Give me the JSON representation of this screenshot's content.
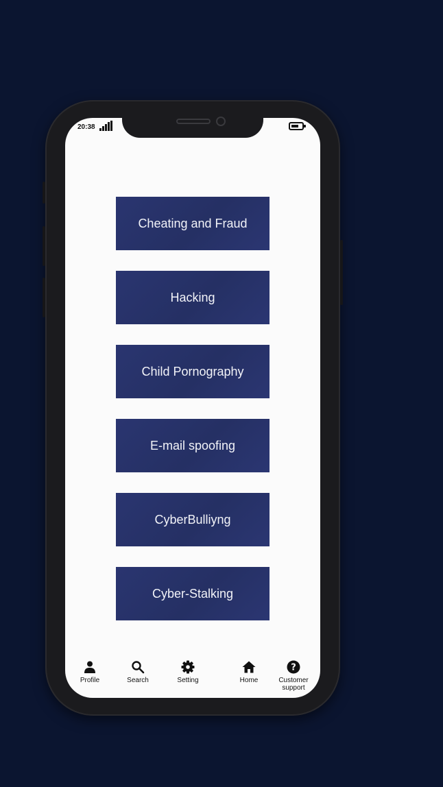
{
  "status_bar": {
    "time": "20:38"
  },
  "categories": [
    {
      "label": "Cheating and Fraud"
    },
    {
      "label": "Hacking"
    },
    {
      "label": "Child Pornography"
    },
    {
      "label": "E-mail spoofing"
    },
    {
      "label": "CyberBulliyng"
    },
    {
      "label": "Cyber-Stalking"
    }
  ],
  "bottom_nav": {
    "items": [
      {
        "label": "Profile",
        "icon": "person-icon"
      },
      {
        "label": "Search",
        "icon": "search-icon"
      },
      {
        "label": "Setting",
        "icon": "gear-icon"
      },
      {
        "label": "Home",
        "icon": "home-icon"
      },
      {
        "label": "Customer\nsupport",
        "icon": "help-icon"
      }
    ]
  },
  "colors": {
    "background": "#0b1530",
    "button": "#263168",
    "screen": "#fbfbfb"
  }
}
